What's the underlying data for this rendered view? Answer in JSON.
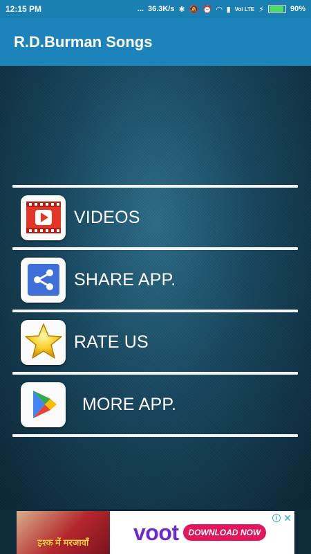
{
  "status_bar": {
    "time": "12:15 PM",
    "dots": "...",
    "speed": "36.3K/s",
    "network": "Voi LTE",
    "battery": "90%",
    "battery_level": 0.9
  },
  "app_bar": {
    "title": "R.D.Burman Songs"
  },
  "menu": {
    "items": [
      {
        "label": "VIDEOS",
        "icon": "video-play-icon"
      },
      {
        "label": "SHARE APP.",
        "icon": "share-icon"
      },
      {
        "label": "RATE US",
        "icon": "star-icon"
      },
      {
        "label": "MORE APP.",
        "icon": "play-store-icon"
      }
    ]
  },
  "ad": {
    "show_title": "इश्क में मरजावाँ",
    "brand": "voot",
    "cta": "DOWNLOAD NOW",
    "close": "✕"
  },
  "colors": {
    "app_bar": "#1c84bb",
    "status_bar": "#1a7fb3",
    "ad_brand": "#6b2ad1",
    "ad_cta": "#e3155c"
  }
}
